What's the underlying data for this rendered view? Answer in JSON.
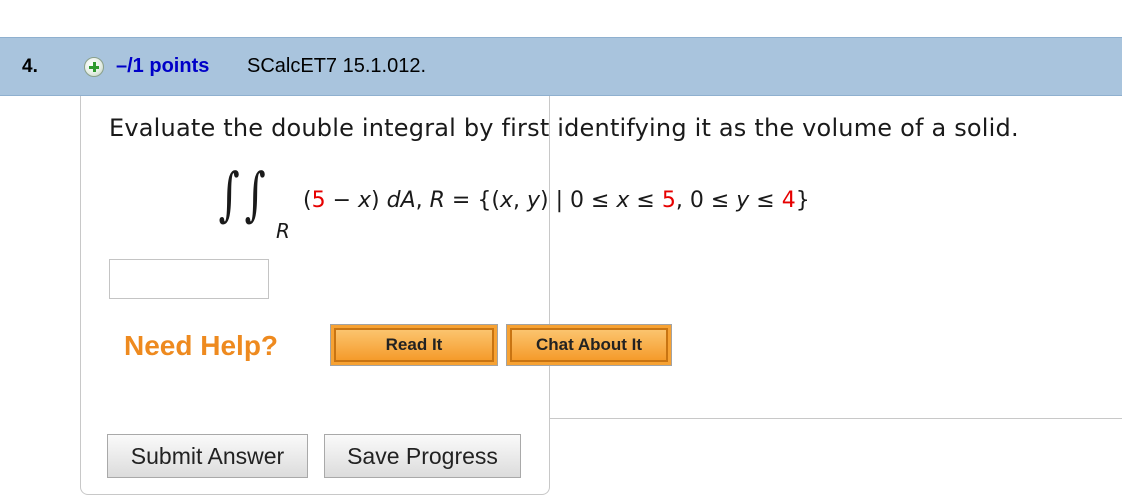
{
  "question": {
    "number": "4.",
    "points": "–/1 points",
    "source": "SCalcET7 15.1.012."
  },
  "problem": {
    "prompt": "Evaluate the double integral by first identifying it as the volume of a solid.",
    "integral_symbol": "∫",
    "region_subscript": "R",
    "formula": {
      "open": "(",
      "a": "5",
      "minus_x": " − ",
      "x_var": "x",
      "close_dA": ") ",
      "dA": "dA",
      "sep": ", ",
      "R": "R",
      "eq": " = {(",
      "x1": "x",
      "comma": ", ",
      "y1": "y",
      "bar": ") | 0 ≤ ",
      "x2": "x",
      "le": " ≤ ",
      "b": "5",
      "mid": ", 0 ≤ ",
      "y2": "y",
      "le2": " ≤ ",
      "c": "4",
      "end": "}"
    }
  },
  "answer": {
    "value": ""
  },
  "help": {
    "label": "Need Help?",
    "read_it": "Read It",
    "chat": "Chat About It"
  },
  "actions": {
    "submit": "Submit Answer",
    "save": "Save Progress"
  },
  "colors": {
    "header_bg": "#a9c4dd",
    "points": "#0000c8",
    "need_help": "#ee8a1f",
    "button_orange": "#f7a233",
    "highlight_red": "#e60000"
  }
}
